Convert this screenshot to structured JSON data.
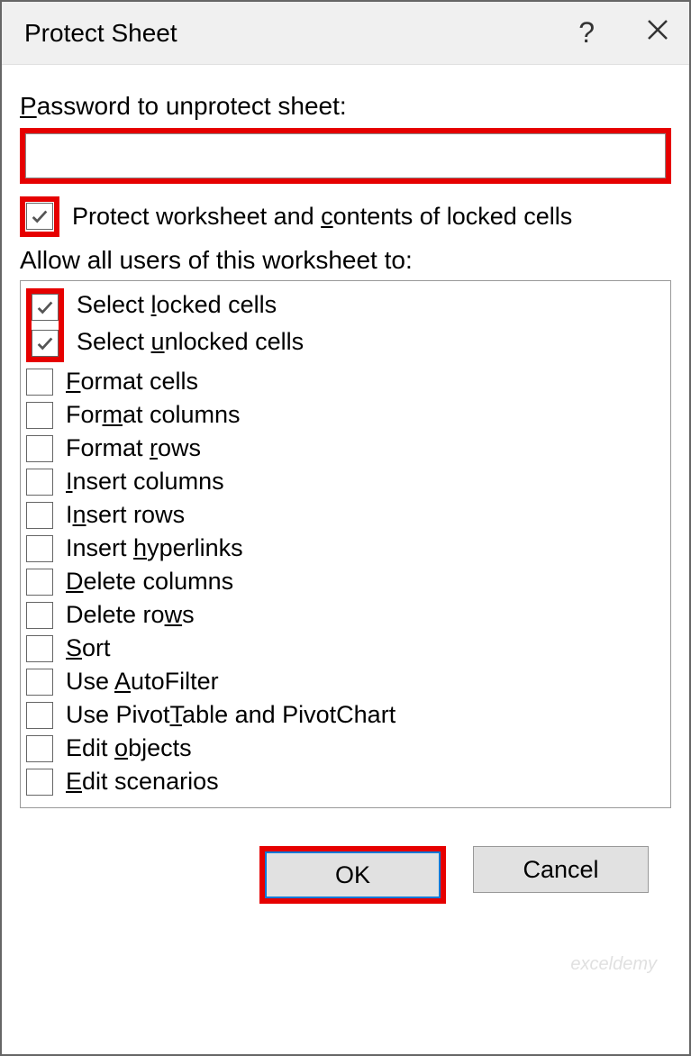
{
  "titlebar": {
    "title": "Protect Sheet"
  },
  "password": {
    "label_pre": "P",
    "label_post": "assword to unprotect sheet:",
    "value": ""
  },
  "protect_checkbox": {
    "label_pre": "Protect worksheet and ",
    "label_u": "c",
    "label_post": "ontents of locked cells",
    "checked": true
  },
  "allow_label": "Allow all users of this worksheet to:",
  "options": [
    {
      "pre": "Select ",
      "u": "l",
      "post": "ocked cells",
      "checked": true
    },
    {
      "pre": "Select ",
      "u": "u",
      "post": "nlocked cells",
      "checked": true
    },
    {
      "pre": "",
      "u": "F",
      "post": "ormat cells",
      "checked": false
    },
    {
      "pre": "For",
      "u": "m",
      "post": "at columns",
      "checked": false
    },
    {
      "pre": "Format ",
      "u": "r",
      "post": "ows",
      "checked": false
    },
    {
      "pre": "",
      "u": "I",
      "post": "nsert columns",
      "checked": false
    },
    {
      "pre": "I",
      "u": "n",
      "post": "sert rows",
      "checked": false
    },
    {
      "pre": "Insert ",
      "u": "h",
      "post": "yperlinks",
      "checked": false
    },
    {
      "pre": "",
      "u": "D",
      "post": "elete columns",
      "checked": false
    },
    {
      "pre": "Delete ro",
      "u": "w",
      "post": "s",
      "checked": false
    },
    {
      "pre": "",
      "u": "S",
      "post": "ort",
      "checked": false
    },
    {
      "pre": "Use ",
      "u": "A",
      "post": "utoFilter",
      "checked": false
    },
    {
      "pre": "Use Pivot",
      "u": "T",
      "post": "able and PivotChart",
      "checked": false
    },
    {
      "pre": "Edit ",
      "u": "o",
      "post": "bjects",
      "checked": false
    },
    {
      "pre": "",
      "u": "E",
      "post": "dit scenarios",
      "checked": false
    }
  ],
  "buttons": {
    "ok": "OK",
    "cancel": "Cancel"
  },
  "watermark": "exceldemy"
}
